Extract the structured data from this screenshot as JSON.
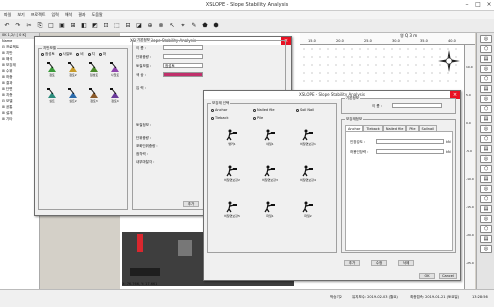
{
  "app": {
    "title": "XSLOPE - Slope Stability Analysis"
  },
  "menu": [
    "파일",
    "보기",
    "프로젝트",
    "입력",
    "해석",
    "결과",
    "도움말"
  ],
  "toolbar": [
    "↶",
    "↷",
    "✂",
    "⎘",
    "□",
    "▣",
    "⊞",
    "◧",
    "◩",
    "⊡",
    "⬚",
    "⊟",
    "◪",
    "⊕",
    "⊗",
    "↖",
    "⌖",
    "✎",
    "⬟",
    "⬢"
  ],
  "left_panel": {
    "header": "0K 1,2/: [ 0 K]",
    "rows": [
      "Name",
      "⊟ 프로젝트",
      "  ⊞ 지반",
      "  ⊞ 해석",
      "  ⊞ 보강재",
      "  ⊞ 수위",
      "  ⊞ 하중",
      "  ⊞ 결과",
      "  ⊞ 단면",
      "  ⊞ 지층",
      "⊟ 모델",
      "  ⊞ 공통",
      "  ⊞ 설계",
      "  ⊞ 기타"
    ],
    "tab_bottom": [
      "데이터",
      "파일트"
    ]
  },
  "ruler": {
    "label": "영 Q 3 m",
    "ticks": [
      "15.0",
      "20.0",
      "25.0",
      "30.0",
      "35.0",
      "40.0"
    ]
  },
  "right_ruler": [
    "10.0",
    "5.0",
    "0.0",
    "-5.0",
    "-10.0",
    "-15.0",
    "-20.0",
    "-25.0"
  ],
  "status": {
    "coord": "X: 76.766, Y: 17.661",
    "items": [
      "박승기2",
      "유지보수: 2019-02-03 (월요)",
      "최종접속: 2019-01-21 (토요일)",
      "13:28:56"
    ]
  },
  "dlg1": {
    "title": "XSLOPE - Slope Stability Analysis",
    "group": "지반모델",
    "radios": [
      "점성토",
      "사질토",
      "비",
      "지",
      "마"
    ],
    "tiles": [
      "점토",
      "점토2",
      "점성토",
      "사질토",
      "실트",
      "실트2",
      "점토3",
      "점토4"
    ],
    "right_group": "기본정보",
    "fields": [
      "이 름 :",
      "단위중량 :",
      "토질모델 :",
      "색 상 :",
      "입 력 :"
    ],
    "model_value": "점성토",
    "extra_labels": [
      "토질정보 :",
      "단위중량 :",
      "포화단위중량 :",
      "점착력 :",
      "내부마찰각 :"
    ],
    "add": "추가"
  },
  "dlg2": {
    "title": "XSLOPE - Slope Stability Analysis",
    "group": "보강재 선택",
    "radios": [
      "Anchor",
      "Nailed file",
      "Soil Nail",
      "Tieback",
      "Pile"
    ],
    "icons": [
      "앵커1",
      "네일1",
      "비탈면보강1",
      "비탈면보강2",
      "비탈면보강3",
      "비탈면보강4",
      "비탈면보강5",
      "파일1",
      "파일2"
    ],
    "info_group": "기본정보",
    "name_label": "이 름 :",
    "settings_group": "보강재정보",
    "tabs": [
      "Anchor",
      "Tieback",
      "Nailed file",
      "Pile",
      "Soilnail"
    ],
    "fields": [
      "인장강도 :",
      "허용인장력 :"
    ],
    "unit": "kN",
    "buttons": [
      "추가",
      "수정",
      "삭제"
    ],
    "ok": "OK",
    "cancel": "Cancel"
  },
  "colors": {
    "titlebar": "#ffffff",
    "dialog_bg": "#f0f0f0",
    "close": "#e81123",
    "green": "#3a9a3a",
    "purple": "#8e44ad",
    "red": "#d9272e",
    "ruler": "#fafafa"
  }
}
